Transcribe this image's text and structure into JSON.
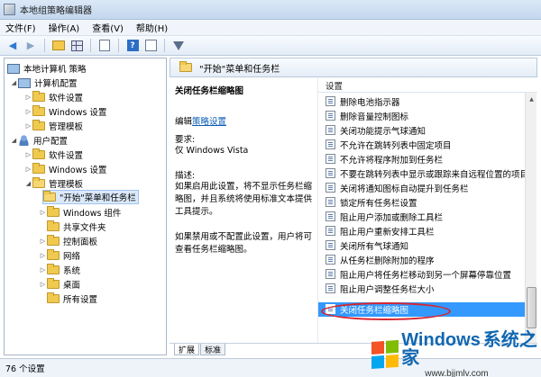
{
  "window": {
    "title": "本地组策略编辑器"
  },
  "menu": [
    "文件(F)",
    "操作(A)",
    "查看(V)",
    "帮助(H)"
  ],
  "toolbar": {
    "icons": [
      "back-arrow-icon",
      "forward-arrow-icon",
      "up-folder-icon",
      "show-hide-tree-icon",
      "export-list-icon",
      "help-icon",
      "properties-icon",
      "filter-icon"
    ]
  },
  "tree": {
    "root": "本地计算机 策略",
    "computer_config": "计算机配置",
    "cc_software": "软件设置",
    "cc_windows": "Windows 设置",
    "cc_admin": "管理模板",
    "user_config": "用户配置",
    "uc_software": "软件设置",
    "uc_windows": "Windows 设置",
    "uc_admin": "管理模板",
    "start_taskbar": "\"开始\"菜单和任务栏",
    "windows_components": "Windows 组件",
    "shared_folders": "共享文件夹",
    "control_panel": "控制面板",
    "network": "网络",
    "system": "系统",
    "desktop": "桌面",
    "all_settings": "所有设置"
  },
  "header": {
    "title": "\"开始\"菜单和任务栏"
  },
  "description": {
    "title": "关闭任务栏缩略图",
    "edit_prefix": "编辑",
    "edit_link": "策略设置",
    "requirements_label": "要求:",
    "requirements_value": "仅 Windows Vista",
    "desc_label": "描述:",
    "desc_text_1": "如果启用此设置，将不显示任务栏缩略图，并且系统将使用标准文本提供工具提示。",
    "desc_text_2": "如果禁用或不配置此设置，用户将可查看任务栏缩略图。"
  },
  "settings": {
    "column_header": "设置",
    "items": [
      "删除电池指示器",
      "删除音量控制图标",
      "关闭功能提示气球通知",
      "不允许在跳转列表中固定项目",
      "不允许将程序附加到任务栏",
      "不要在跳转列表中显示或跟踪来自远程位置的项目",
      "关闭将通知图标自动提升到任务栏",
      "锁定所有任务栏设置",
      "阻止用户添加或删除工具栏",
      "阻止用户重新安排工具栏",
      "关闭所有气球通知",
      "从任务栏删除附加的程序",
      "阻止用户将任务栏移动到另一个屏幕停靠位置",
      "阻止用户调整任务栏大小",
      "关闭任务栏缩略图"
    ],
    "selected_index": 14
  },
  "tabs": [
    "扩展",
    "标准"
  ],
  "status": {
    "text": "76 个设置"
  },
  "watermark": {
    "brand": "Windows",
    "brand_cn": "系统之家",
    "url": "www.bjjmlv.com"
  }
}
